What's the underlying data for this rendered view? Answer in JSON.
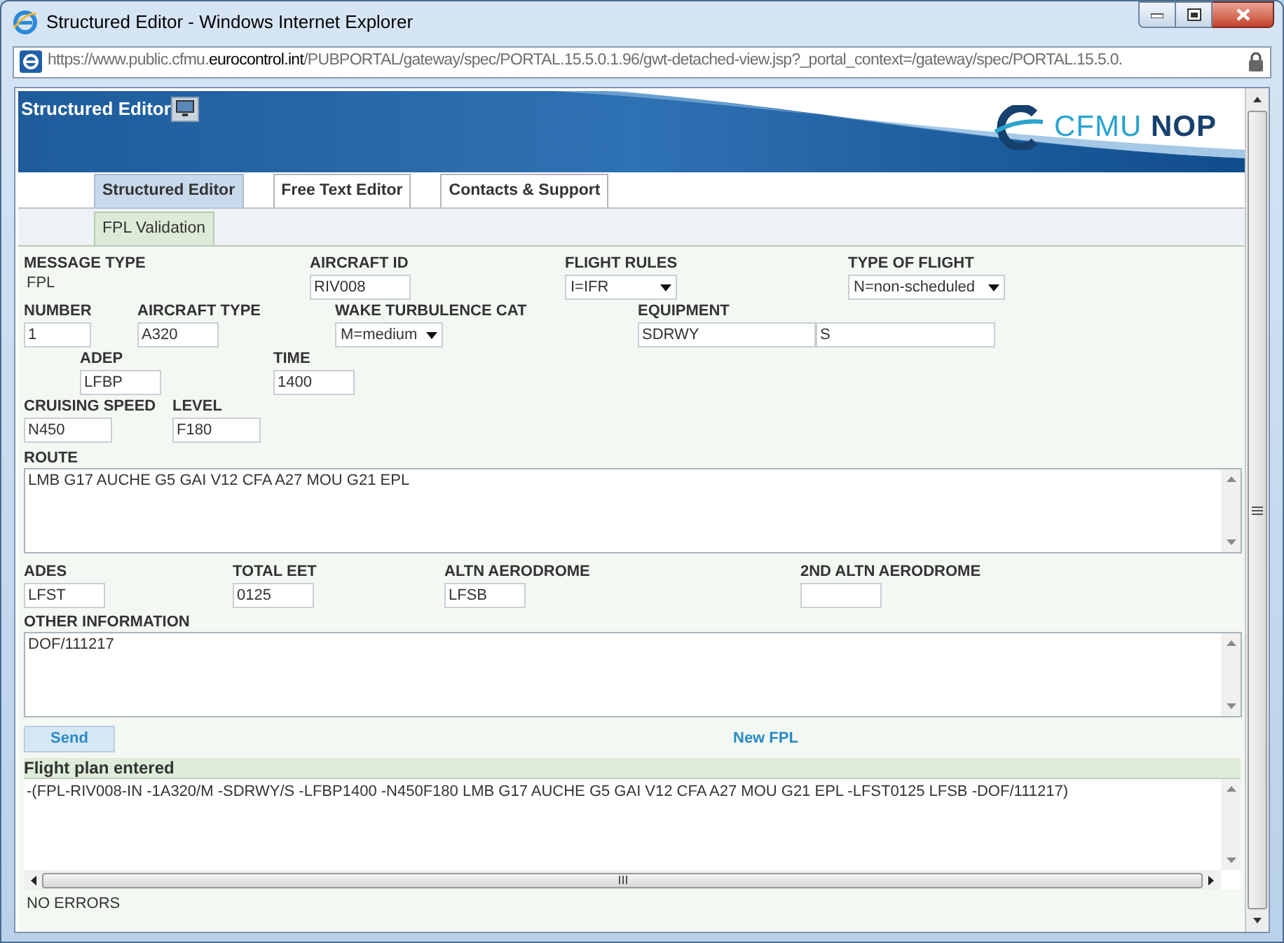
{
  "window": {
    "title": "Structured Editor - Windows Internet Explorer"
  },
  "address_bar": {
    "url_prefix": "https://www.public.cfmu.",
    "url_domain": "eurocontrol.int",
    "url_suffix": "/PUBPORTAL/gateway/spec/PORTAL.15.5.0.1.96/gwt-detached-view.jsp?_portal_context=/gateway/spec/PORTAL.15.5.0."
  },
  "header": {
    "title": "Structured Editor",
    "logo_light": "CFMU",
    "logo_bold": "NOP"
  },
  "tabs": [
    {
      "label": "Structured Editor",
      "selected": true
    },
    {
      "label": "Free Text Editor",
      "selected": false
    },
    {
      "label": "Contacts & Support",
      "selected": false
    }
  ],
  "subtabs": [
    {
      "label": "FPL Validation",
      "selected": true
    }
  ],
  "form": {
    "fields": [
      {
        "kind": "static",
        "label": "MESSAGE TYPE",
        "value": "FPL"
      },
      {
        "kind": "text",
        "label": "AIRCRAFT ID",
        "value": "RIV008"
      },
      {
        "kind": "select",
        "label": "FLIGHT RULES",
        "value": "I=IFR"
      },
      {
        "kind": "select",
        "label": "TYPE OF FLIGHT",
        "value": "N=non-scheduled"
      },
      {
        "kind": "text",
        "label": "NUMBER",
        "value": "1"
      },
      {
        "kind": "text",
        "label": "AIRCRAFT TYPE",
        "value": "A320"
      },
      {
        "kind": "select",
        "label": "WAKE TURBULENCE CAT",
        "value": "M=medium"
      },
      {
        "kind": "pair",
        "label": "EQUIPMENT",
        "values": [
          "SDRWY",
          "S"
        ]
      },
      {
        "kind": "text",
        "label": "ADEP",
        "value": "LFBP"
      },
      {
        "kind": "text",
        "label": "TIME",
        "value": "1400"
      },
      {
        "kind": "text",
        "label": "CRUISING SPEED",
        "value": "N450"
      },
      {
        "kind": "text",
        "label": "LEVEL",
        "value": "F180"
      }
    ],
    "route": {
      "label": "ROUTE",
      "value": "LMB G17 AUCHE G5 GAI V12 CFA A27 MOU G21 EPL"
    },
    "destination_row": [
      {
        "kind": "text",
        "label": "ADES",
        "value": "LFST"
      },
      {
        "kind": "text",
        "label": "TOTAL EET",
        "value": "0125"
      },
      {
        "kind": "text",
        "label": "ALTN AERODROME",
        "value": "LFSB"
      },
      {
        "kind": "text",
        "label": "2ND ALTN AERODROME"
      }
    ],
    "other_information": {
      "label": "OTHER INFORMATION",
      "value": "DOF/111217"
    },
    "send_button": "Send",
    "new_fpl_link": "New FPL"
  },
  "result": {
    "title": "Flight plan entered",
    "message": "-(FPL-RIV008-IN -1A320/M -SDRWY/S -LFBP1400 -N450F180 LMB G17 AUCHE G5 GAI V12 CFA A27 MOU G21 EPL -LFST0125 LFSB -DOF/111217)",
    "status": "NO ERRORS"
  }
}
